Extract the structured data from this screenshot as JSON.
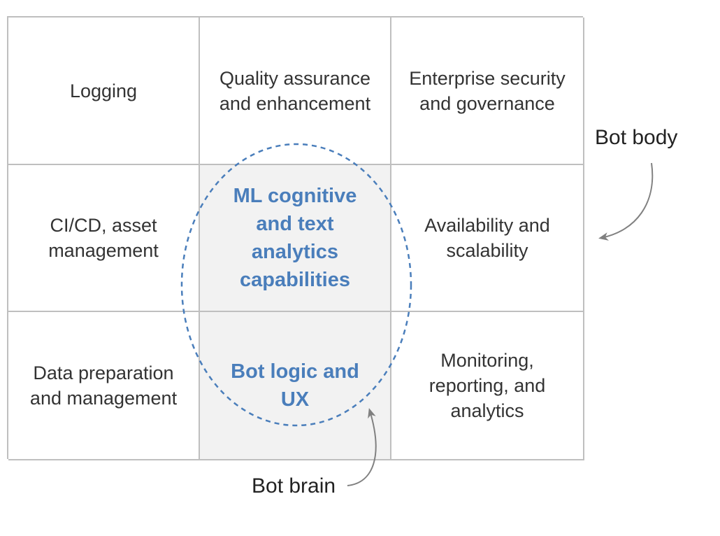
{
  "cells": [
    {
      "text": "Logging",
      "group": "body"
    },
    {
      "text": "Quality assurance\nand enhancement",
      "group": "body"
    },
    {
      "text": "Enterprise security\nand governance",
      "group": "body"
    },
    {
      "text": "CI/CD, asset\nmanagement",
      "group": "body"
    },
    {
      "text": "ML cognitive\nand text\nanalytics\ncapabilities",
      "group": "brain"
    },
    {
      "text": "Availability and\nscalability",
      "group": "body"
    },
    {
      "text": "Data preparation\nand management",
      "group": "body"
    },
    {
      "text": "Bot logic and\nUX",
      "group": "brain"
    },
    {
      "text": "Monitoring,\nreporting, and\nanalytics",
      "group": "body"
    }
  ],
  "labels": {
    "bot_body": "Bot body",
    "bot_brain": "Bot brain"
  },
  "colors": {
    "brain_text": "#4a7ebb",
    "brain_fill": "#f2f2f2",
    "grid_line": "#bfbfbf",
    "ellipse_stroke": "#4a7ebb",
    "arrow": "#808080"
  }
}
